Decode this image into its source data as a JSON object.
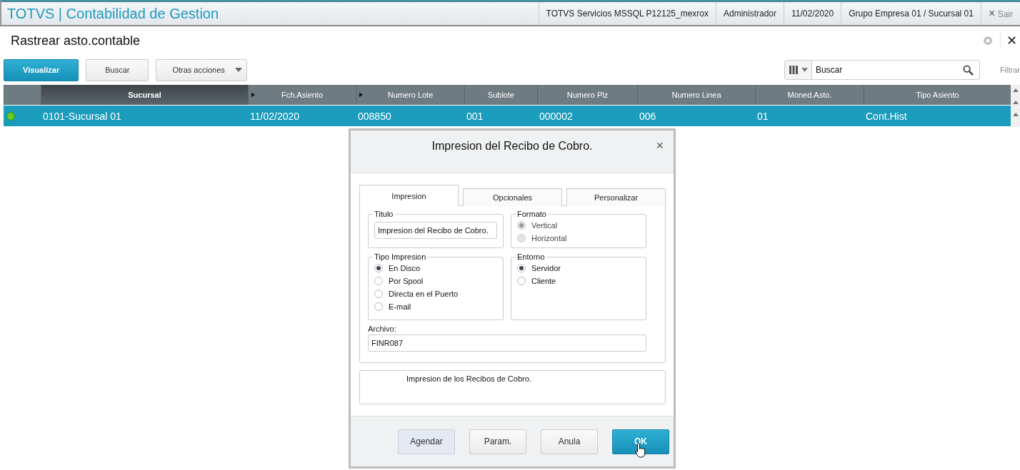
{
  "app_bar": {
    "title": "TOTVS | Contabilidad de Gestion",
    "items": [
      "TOTVS Servicios MSSQL P12125_mexrox",
      "Administrador",
      "11/02/2020",
      "Grupo Empresa 01 / Sucursal 01"
    ],
    "exit": {
      "icon": "×",
      "label": "Sair"
    }
  },
  "page": {
    "title": "Rastrear asto.contable",
    "close": "✕"
  },
  "toolbar": {
    "buttons": [
      {
        "label": "Visualizar",
        "kind": "primary"
      },
      {
        "label": "Buscar",
        "kind": "default"
      },
      {
        "label": "Otras acciones",
        "kind": "menu"
      }
    ],
    "search": {
      "value": "Buscar"
    },
    "filter": "Filtrar"
  },
  "table": {
    "columns": [
      {
        "label": "Sucursal",
        "sorted": true,
        "arrow": false
      },
      {
        "label": "Fch.Asiento",
        "sorted": false,
        "arrow": true
      },
      {
        "label": "Numero Lote",
        "sorted": false,
        "arrow": true
      },
      {
        "label": "Sublote",
        "sorted": false,
        "arrow": false
      },
      {
        "label": "Numero Plz",
        "sorted": false,
        "arrow": false
      },
      {
        "label": "Numero Linea",
        "sorted": false,
        "arrow": false
      },
      {
        "label": "Moned.Asto.",
        "sorted": false,
        "arrow": false
      },
      {
        "label": "Tipo Asiento",
        "sorted": false,
        "arrow": false
      }
    ],
    "rows": [
      {
        "selected": true,
        "color": "#66cc22",
        "cells": [
          "0101-Sucursal 01",
          "11/02/2020",
          "008850",
          "001",
          "000002",
          "006",
          "01",
          "Cont.Hist"
        ]
      }
    ]
  },
  "dialog": {
    "title": "Impresion del Recibo de Cobro.",
    "close": "×",
    "tabs": [
      {
        "label": "Impresion",
        "selected": true
      },
      {
        "label": "Opcionales",
        "selected": false
      },
      {
        "label": "Personalizar",
        "selected": false
      }
    ],
    "titulo": {
      "label": "Titulo",
      "value": "Impresion del Recibo de Cobro."
    },
    "formato": {
      "label": "Formato",
      "disabled": true,
      "options": [
        {
          "label": "Vertical",
          "selected": true
        },
        {
          "label": "Horizontal",
          "selected": false
        }
      ]
    },
    "tipo_impresion": {
      "label": "Tipo Impresion",
      "disabled": false,
      "options": [
        {
          "label": "En Disco",
          "selected": true
        },
        {
          "label": "Por Spool",
          "selected": false
        },
        {
          "label": "Directa en el Puerto",
          "selected": false
        },
        {
          "label": "E-mail",
          "selected": false
        }
      ]
    },
    "entorno": {
      "label": "Entorno",
      "disabled": false,
      "options": [
        {
          "label": "Servidor",
          "selected": true
        },
        {
          "label": "Cliente",
          "selected": false
        }
      ]
    },
    "archivo": {
      "label": "Archivo:",
      "value": "FINR087"
    },
    "description": "Impresion de los Recibos de Cobro.",
    "buttons": [
      {
        "label": "Agendar",
        "kind": "focused"
      },
      {
        "label": "Param.",
        "kind": "default"
      },
      {
        "label": "Anula",
        "kind": "default"
      },
      {
        "label": "OK",
        "kind": "primary"
      }
    ]
  }
}
